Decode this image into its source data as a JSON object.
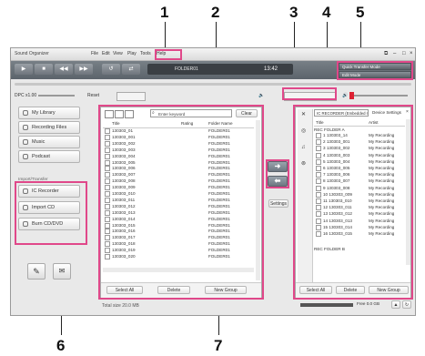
{
  "callouts": [
    "1",
    "2",
    "3",
    "4",
    "5",
    "6",
    "7"
  ],
  "window": {
    "title": "Sound Organizer",
    "menu": [
      "File",
      "Edit",
      "View",
      "Play",
      "Tools",
      "Help"
    ],
    "folder_display": "FOLDER01",
    "time": "13:42",
    "speed_label": "DPC x1.00",
    "reset_label": "Reset",
    "sort_label": "Quick Transfer Mode",
    "edit_label": "Edit Mode"
  },
  "sidebar": {
    "items": [
      {
        "label": "My Library",
        "icon": "library-icon"
      },
      {
        "label": "Recording Files",
        "icon": "recording-files-icon"
      },
      {
        "label": "Music",
        "icon": "music-icon"
      },
      {
        "label": "Podcast",
        "icon": "podcast-icon"
      }
    ],
    "import_header": "Import/Transfer",
    "import_items": [
      {
        "label": "IC Recorder",
        "icon": "ic-recorder-icon"
      },
      {
        "label": "Import CD",
        "icon": "cd-import-icon"
      },
      {
        "label": "Burn CD/DVD",
        "icon": "cd-burn-icon"
      }
    ]
  },
  "library": {
    "search_placeholder": "Enter keyword",
    "search_button": "Clear",
    "columns": [
      "Title",
      "Rating",
      "Folder Name"
    ],
    "rows": [
      {
        "title": "130303_01",
        "folder": "FOLDER01"
      },
      {
        "title": "130303_001",
        "folder": "FOLDER01"
      },
      {
        "title": "130303_002",
        "folder": "FOLDER01"
      },
      {
        "title": "130303_003",
        "folder": "FOLDER01"
      },
      {
        "title": "130303_004",
        "folder": "FOLDER01"
      },
      {
        "title": "130303_005",
        "folder": "FOLDER01"
      },
      {
        "title": "130303_006",
        "folder": "FOLDER01"
      },
      {
        "title": "130303_007",
        "folder": "FOLDER01"
      },
      {
        "title": "130303_008",
        "folder": "FOLDER01"
      },
      {
        "title": "130303_009",
        "folder": "FOLDER01"
      },
      {
        "title": "130303_010",
        "folder": "FOLDER01"
      },
      {
        "title": "130303_011",
        "folder": "FOLDER01"
      },
      {
        "title": "130303_012",
        "folder": "FOLDER01"
      },
      {
        "title": "130303_013",
        "folder": "FOLDER01"
      },
      {
        "title": "130303_014",
        "folder": "FOLDER01"
      },
      {
        "title": "130303_015",
        "folder": "FOLDER01"
      },
      {
        "title": "130303_016",
        "folder": "FOLDER01"
      },
      {
        "title": "130303_017",
        "folder": "FOLDER01"
      },
      {
        "title": "130303_018",
        "folder": "FOLDER01"
      },
      {
        "title": "130303_019",
        "folder": "FOLDER01"
      },
      {
        "title": "130303_020",
        "folder": "FOLDER01"
      }
    ],
    "select_all": "Select All",
    "delete": "Delete",
    "new_group": "New Group",
    "status": "Total size 20.0 MB"
  },
  "device": {
    "header": "IC RECORDER (Embedded me...",
    "settings": "Device Settings",
    "columns": [
      "Title",
      "Artist"
    ],
    "folder_a": "REC FOLDER A",
    "rows": [
      {
        "title": "1 130303_14",
        "artist": "My Recording"
      },
      {
        "title": "2 130303_001",
        "artist": "My Recording"
      },
      {
        "title": "3 130303_002",
        "artist": "My Recording"
      },
      {
        "title": "4 130303_003",
        "artist": "My Recording"
      },
      {
        "title": "5 130303_004",
        "artist": "My Recording"
      },
      {
        "title": "6 130303_005",
        "artist": "My Recording"
      },
      {
        "title": "7 130303_006",
        "artist": "My Recording"
      },
      {
        "title": "8 130303_007",
        "artist": "My Recording"
      },
      {
        "title": "9 130303_008",
        "artist": "My Recording"
      },
      {
        "title": "10 130303_009",
        "artist": "My Recording"
      },
      {
        "title": "11 130303_010",
        "artist": "My Recording"
      },
      {
        "title": "12 130303_011",
        "artist": "My Recording"
      },
      {
        "title": "13 130303_012",
        "artist": "My Recording"
      },
      {
        "title": "14 130303_013",
        "artist": "My Recording"
      },
      {
        "title": "15 130303_014",
        "artist": "My Recording"
      },
      {
        "title": "16 130303_015",
        "artist": "My Recording"
      }
    ],
    "folder_b": "REC FOLDER B",
    "select_all": "Select All",
    "delete": "Delete",
    "new_group": "New Group",
    "free_space": "Free 0.0 GB"
  },
  "transfer": {
    "settings": "Settings"
  },
  "colors": {
    "callout_border": "#e0488a",
    "button_gray": "#7a838b"
  }
}
